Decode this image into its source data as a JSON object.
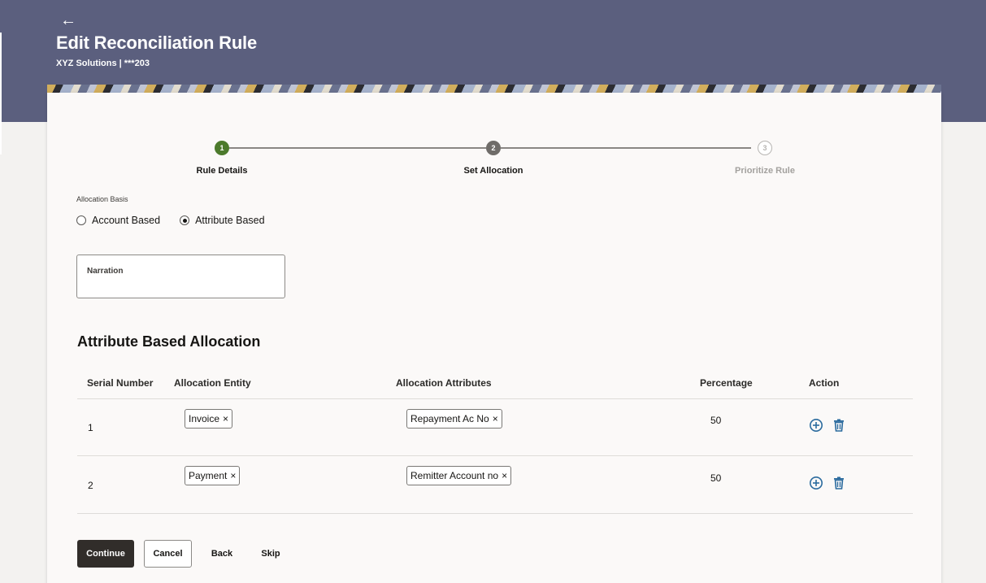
{
  "header": {
    "back_icon": "back-arrow-icon",
    "title": "Edit Reconciliation Rule",
    "subtitle": "XYZ Solutions | ***203"
  },
  "stepper": {
    "steps": [
      {
        "number": "1",
        "label": "Rule Details",
        "state": "completed",
        "color": "#4c7a2c"
      },
      {
        "number": "2",
        "label": "Set Allocation",
        "state": "active",
        "color": "#6f6c69"
      },
      {
        "number": "3",
        "label": "Prioritize Rule",
        "state": "pending",
        "color": "#b7b5b2"
      }
    ]
  },
  "allocation_basis": {
    "label": "Allocation Basis",
    "options": [
      "Account Based",
      "Attribute Based"
    ],
    "selected": "Attribute Based"
  },
  "narration": {
    "label": "Narration",
    "value": ""
  },
  "table": {
    "title": "Attribute Based Allocation",
    "columns": [
      "Serial Number",
      "Allocation Entity",
      "Allocation Attributes",
      "Percentage",
      "Action"
    ],
    "rows": [
      {
        "serial": "1",
        "entity": "Invoice",
        "attribute": "Repayment Ac No",
        "percentage": "50"
      },
      {
        "serial": "2",
        "entity": "Payment",
        "attribute": "Remitter Account no",
        "percentage": "50"
      }
    ],
    "chip_remove_glyph": "×",
    "action_icons": [
      "add-circle-icon",
      "trash-icon"
    ],
    "action_color": "#2b6b9e"
  },
  "footer": {
    "continue_label": "Continue",
    "cancel_label": "Cancel",
    "back_label": "Back",
    "skip_label": "Skip"
  }
}
